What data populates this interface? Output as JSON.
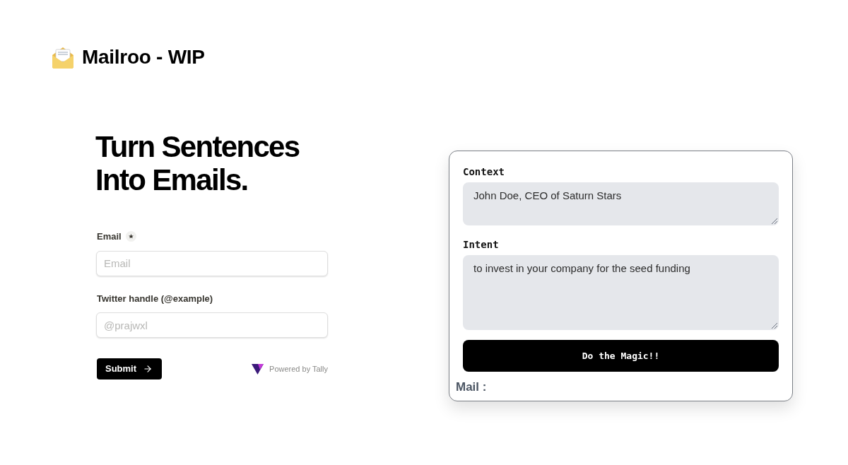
{
  "header": {
    "title": "Mailroo - WIP"
  },
  "hero": {
    "heading_lines": [
      "Turn Sentences",
      "Into Emails."
    ]
  },
  "signup_form": {
    "fields": [
      {
        "label": "Email",
        "required": true,
        "placeholder": "Email"
      },
      {
        "label": "Twitter handle (@example)",
        "required": false,
        "placeholder": "@prajwxl"
      }
    ],
    "submit": "Submit",
    "powered_by": "Powered by Tally"
  },
  "generator": {
    "fields": [
      {
        "label": "Context",
        "value": "John Doe, CEO of Saturn Stars"
      },
      {
        "label": "Intent",
        "value": "to invest in your company for the seed funding"
      }
    ],
    "button": "Do the Magic!!",
    "output_label": "Mail :"
  }
}
